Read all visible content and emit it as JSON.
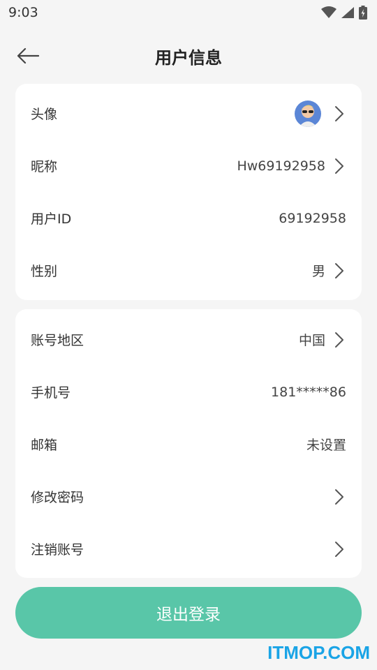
{
  "status_bar": {
    "time": "9:03",
    "icons": [
      "wifi-icon",
      "signal-icon",
      "battery-charging-icon"
    ]
  },
  "header": {
    "title": "用户信息",
    "back_icon": "arrow-left-icon"
  },
  "profile_card": {
    "avatar_label": "头像",
    "nickname_label": "昵称",
    "nickname_value": "Hw69192958",
    "user_id_label": "用户ID",
    "user_id_value": "69192958",
    "gender_label": "性别",
    "gender_value": "男"
  },
  "account_card": {
    "region_label": "账号地区",
    "region_value": "中国",
    "phone_label": "手机号",
    "phone_value": "181*****86",
    "email_label": "邮箱",
    "email_value": "未设置",
    "change_password_label": "修改密码",
    "delete_account_label": "注销账号"
  },
  "logout_button": {
    "label": "退出登录"
  },
  "watermark": "ITMOP.COM",
  "colors": {
    "accent": "#59c6a8",
    "background": "#f5f5f5",
    "card": "#ffffff",
    "watermark": "#1aa4e6"
  }
}
